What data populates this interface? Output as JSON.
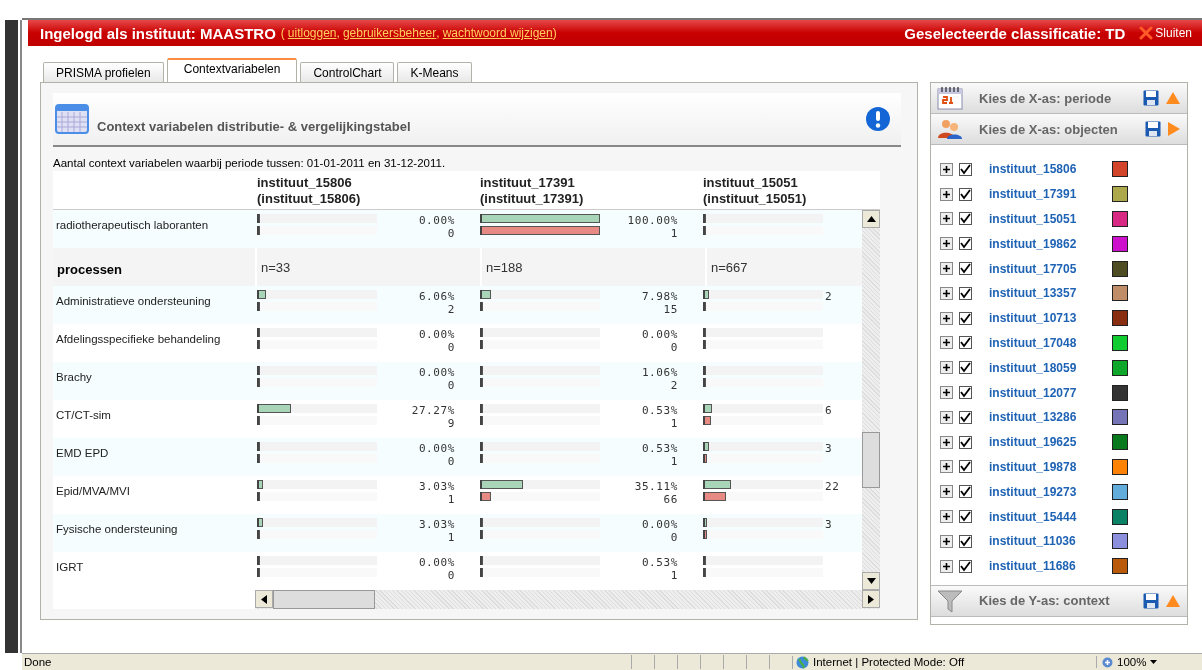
{
  "header": {
    "login": "Ingelogd als instituut: MAASTRO",
    "open": "(",
    "links": [
      {
        "label": "uitloggen",
        "sep": ","
      },
      {
        "label": "gebruikersbeheer",
        "sep": ","
      },
      {
        "label": "wachtwoord wijzigen",
        "sep": ")"
      }
    ],
    "classification": "Geselecteerde classificatie: TD",
    "close": "Sluiten"
  },
  "tabs": [
    {
      "label": "PRISMA profielen",
      "selected": false
    },
    {
      "label": "Contextvariabelen",
      "selected": true
    },
    {
      "label": "ControlChart",
      "selected": false
    },
    {
      "label": "K-Means",
      "selected": false
    }
  ],
  "panel": {
    "title": "Context variabelen distributie- & vergelijkingstabel",
    "subtitle": "Aantal context variabelen waarbij periode tussen: 01-01-2011 en 31-12-2011."
  },
  "table": {
    "columns": [
      {
        "name": "instituut_15806",
        "alias": "(instituut_15806)"
      },
      {
        "name": "instituut_17391",
        "alias": "(instituut_17391)"
      },
      {
        "name": "instituut_15051",
        "alias": "(instituut_15051)"
      }
    ],
    "rows": [
      {
        "kind": "value",
        "label": "radiotherapeutisch laboranten",
        "cells": [
          {
            "pct": "0.00%",
            "count": "0",
            "bars": [
              {
                "level": 0
              },
              {
                "level": 0
              }
            ]
          },
          {
            "pct": "100.00%",
            "count": "1",
            "bars": [
              {
                "level": 1
              },
              {
                "level": 1
              }
            ]
          },
          {
            "bars": [
              {
                "level": 0
              },
              {
                "level": 0
              }
            ]
          }
        ]
      },
      {
        "kind": "group",
        "label": "processen",
        "cells": [
          {
            "n": "n=33"
          },
          {
            "n": "n=188"
          },
          {
            "n": "n=667"
          }
        ]
      },
      {
        "kind": "value",
        "label": "Administratieve ondersteuning",
        "cells": [
          {
            "pct": "6.06%",
            "count": "2",
            "bars": [
              {
                "level": 0.06
              },
              {
                "level": 0
              }
            ]
          },
          {
            "pct": "7.98%",
            "count": "15",
            "bars": [
              {
                "level": 0.08
              },
              {
                "level": 0
              }
            ]
          },
          {
            "pct": "2",
            "bars": [
              {
                "level": 0.03
              },
              {
                "level": 0
              }
            ]
          }
        ]
      },
      {
        "kind": "value",
        "label": "Afdelingsspecifieke behandeling",
        "cells": [
          {
            "pct": "0.00%",
            "count": "0",
            "bars": [
              {
                "level": 0
              },
              {
                "level": 0
              }
            ]
          },
          {
            "pct": "0.00%",
            "count": "0",
            "bars": [
              {
                "level": 0
              },
              {
                "level": 0
              }
            ]
          },
          {
            "bars": [
              {
                "level": 0
              },
              {
                "level": 0
              }
            ]
          }
        ]
      },
      {
        "kind": "value",
        "label": "Brachy",
        "cells": [
          {
            "pct": "0.00%",
            "count": "0",
            "bars": [
              {
                "level": 0
              },
              {
                "level": 0
              }
            ]
          },
          {
            "pct": "1.06%",
            "count": "2",
            "bars": [
              {
                "level": 0
              },
              {
                "level": 0
              }
            ]
          },
          {
            "bars": [
              {
                "level": 0
              },
              {
                "level": 0
              }
            ]
          }
        ]
      },
      {
        "kind": "value",
        "label": "CT/CT-sim",
        "cells": [
          {
            "pct": "27.27%",
            "count": "9",
            "bars": [
              {
                "level": 0.27
              },
              {
                "level": 0
              }
            ]
          },
          {
            "pct": "0.53%",
            "count": "1",
            "bars": [
              {
                "level": 0
              },
              {
                "level": 0
              }
            ]
          },
          {
            "pct": "6",
            "bars": [
              {
                "level": 0.06
              },
              {
                "level": 0.05
              }
            ]
          }
        ]
      },
      {
        "kind": "value",
        "label": "EMD EPD",
        "cells": [
          {
            "pct": "0.00%",
            "count": "0",
            "bars": [
              {
                "level": 0
              },
              {
                "level": 0
              }
            ]
          },
          {
            "pct": "0.53%",
            "count": "1",
            "bars": [
              {
                "level": 0
              },
              {
                "level": 0
              }
            ]
          },
          {
            "pct": "3",
            "bars": [
              {
                "level": 0.03
              },
              {
                "level": 0.02
              }
            ]
          }
        ]
      },
      {
        "kind": "value",
        "label": "Epid/MVA/MVI",
        "cells": [
          {
            "pct": "3.03%",
            "count": "1",
            "bars": [
              {
                "level": 0.03
              },
              {
                "level": 0
              }
            ]
          },
          {
            "pct": "35.11%",
            "count": "66",
            "bars": [
              {
                "level": 0.35
              },
              {
                "level": 0.08
              }
            ]
          },
          {
            "pct": "22",
            "bars": [
              {
                "level": 0.22
              },
              {
                "level": 0.18
              }
            ]
          }
        ]
      },
      {
        "kind": "value",
        "label": "Fysische ondersteuning",
        "cells": [
          {
            "pct": "3.03%",
            "count": "1",
            "bars": [
              {
                "level": 0.03
              },
              {
                "level": 0
              }
            ]
          },
          {
            "pct": "0.00%",
            "count": "0",
            "bars": [
              {
                "level": 0
              },
              {
                "level": 0
              }
            ]
          },
          {
            "pct": "3",
            "bars": [
              {
                "level": 0.02
              },
              {
                "level": 0.02
              }
            ]
          }
        ]
      },
      {
        "kind": "value",
        "label": "IGRT",
        "cells": [
          {
            "pct": "0.00%",
            "count": "0",
            "bars": [
              {
                "level": 0
              },
              {
                "level": 0
              }
            ]
          },
          {
            "pct": "0.53%",
            "count": "1",
            "bars": [
              {
                "level": 0
              },
              {
                "level": 0
              }
            ]
          },
          {
            "bars": [
              {
                "level": 0
              },
              {
                "level": 0
              }
            ]
          }
        ]
      }
    ]
  },
  "right_panel": {
    "sections": [
      {
        "title": "Kies de X-as: periode",
        "expanded": false
      },
      {
        "title": "Kies de X-as: objecten",
        "expanded": true,
        "items": [
          {
            "name": "instituut_15806",
            "checked": true,
            "color": "#d2452a"
          },
          {
            "name": "instituut_17391",
            "checked": true,
            "color": "#aea84c"
          },
          {
            "name": "instituut_15051",
            "checked": true,
            "color": "#d82a84"
          },
          {
            "name": "instituut_19862",
            "checked": true,
            "color": "#cc10cc"
          },
          {
            "name": "instituut_17705",
            "checked": true,
            "color": "#4e4c22"
          },
          {
            "name": "instituut_13357",
            "checked": true,
            "color": "#bf8e68"
          },
          {
            "name": "instituut_10713",
            "checked": true,
            "color": "#8a2e12"
          },
          {
            "name": "instituut_17048",
            "checked": true,
            "color": "#10cc30"
          },
          {
            "name": "instituut_18059",
            "checked": true,
            "color": "#10a82a"
          },
          {
            "name": "instituut_12077",
            "checked": true,
            "color": "#333333"
          },
          {
            "name": "instituut_13286",
            "checked": true,
            "color": "#7474b6"
          },
          {
            "name": "instituut_19625",
            "checked": true,
            "color": "#0a7a1e"
          },
          {
            "name": "instituut_19878",
            "checked": true,
            "color": "#fe8204"
          },
          {
            "name": "instituut_19273",
            "checked": true,
            "color": "#62acdc"
          },
          {
            "name": "instituut_15444",
            "checked": true,
            "color": "#0a8266"
          },
          {
            "name": "instituut_11036",
            "checked": true,
            "color": "#8c90dc"
          },
          {
            "name": "instituut_11686",
            "checked": true,
            "color": "#b85a0a"
          }
        ]
      },
      {
        "title": "Kies de Y-as: context",
        "expanded": false
      }
    ]
  },
  "status_bar": {
    "status": "Done",
    "zone": "Internet | Protected Mode: Off",
    "zoom": "100%"
  }
}
